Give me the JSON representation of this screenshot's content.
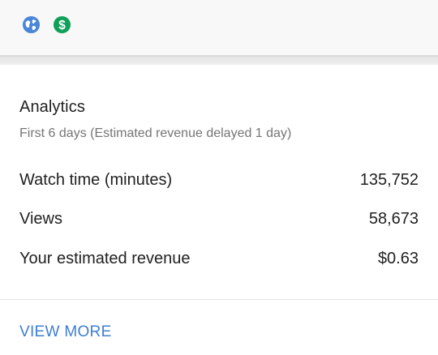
{
  "header": {
    "icons": [
      "globe-icon",
      "dollar-icon"
    ],
    "colors": {
      "globe": "#4a86d8",
      "dollar": "#11a05a"
    }
  },
  "analytics": {
    "title": "Analytics",
    "subtitle": "First 6 days (Estimated revenue delayed 1 day)",
    "rows": [
      {
        "label": "Watch time (minutes)",
        "value": "135,752"
      },
      {
        "label": "Views",
        "value": "58,673"
      },
      {
        "label": "Your estimated revenue",
        "value": "$0.63"
      }
    ],
    "view_more_label": "VIEW MORE"
  },
  "colors": {
    "accent": "#3e7ed1",
    "text_primary": "#212121",
    "text_secondary": "#757575"
  }
}
